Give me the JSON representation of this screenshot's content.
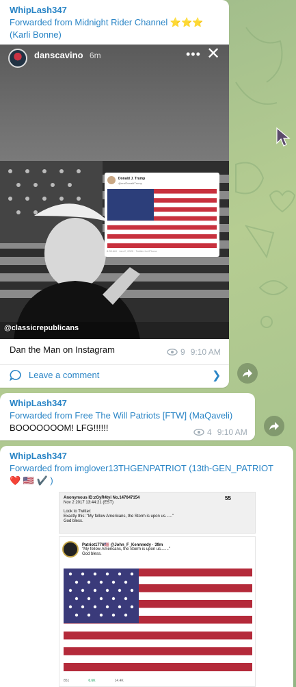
{
  "colors": {
    "accent": "#2a85c6",
    "background": "#a9c48e",
    "meta": "#a0acb6"
  },
  "messages": [
    {
      "sender": "WhipLash347",
      "forwarded": "Forwarded from Midnight Rider Channel ⭐⭐⭐ (Karli Bonne)",
      "story": {
        "user": "danscavino",
        "time": "6m",
        "tag": "@classicrepublicans",
        "tweet_name": "Donald J. Trump",
        "tweet_handle": "@realDonaldTrump",
        "tweet_footer": "8:33 AM · Jan 2, 2020 · Twitter for iPhone"
      },
      "caption": "Dan the Man on Instagram",
      "views": "9",
      "time": "9:10 AM",
      "comment_label": "Leave a comment"
    },
    {
      "sender": "WhipLash347",
      "forwarded": "Forwarded from Free The Will Patriots [FTW] (MaQaveli)",
      "text": "BOOOOOOOM! LFG!!!!!!",
      "views": "4",
      "time": "9:10 AM"
    },
    {
      "sender": "WhipLash347",
      "forwarded": "Forwarded from imglover13THGENPATRIOT (13th-GEN_PATRIOT ❤️ 🇺🇸 ✔️ )",
      "chan_header": "Anonymous  ID:zGyR4tyi  No.147647154",
      "chan_date": "Nov 2 2017 13:44:21 (EST)",
      "chan_num": "55",
      "chan_body": [
        "Look to Twitter:",
        "Exactly this: \"My fellow Americans, the Storm is upon us......\"",
        "God bless."
      ],
      "tweet_name": "Patriot1776🇺🇸 @John_F_Kennnedy · 39m",
      "tweet_body": [
        "\"My fellow Americans, the Storm is upon us.......\"",
        "God bless."
      ],
      "tweet_stats": [
        "851",
        "6.6K",
        "14.4K"
      ]
    }
  ]
}
